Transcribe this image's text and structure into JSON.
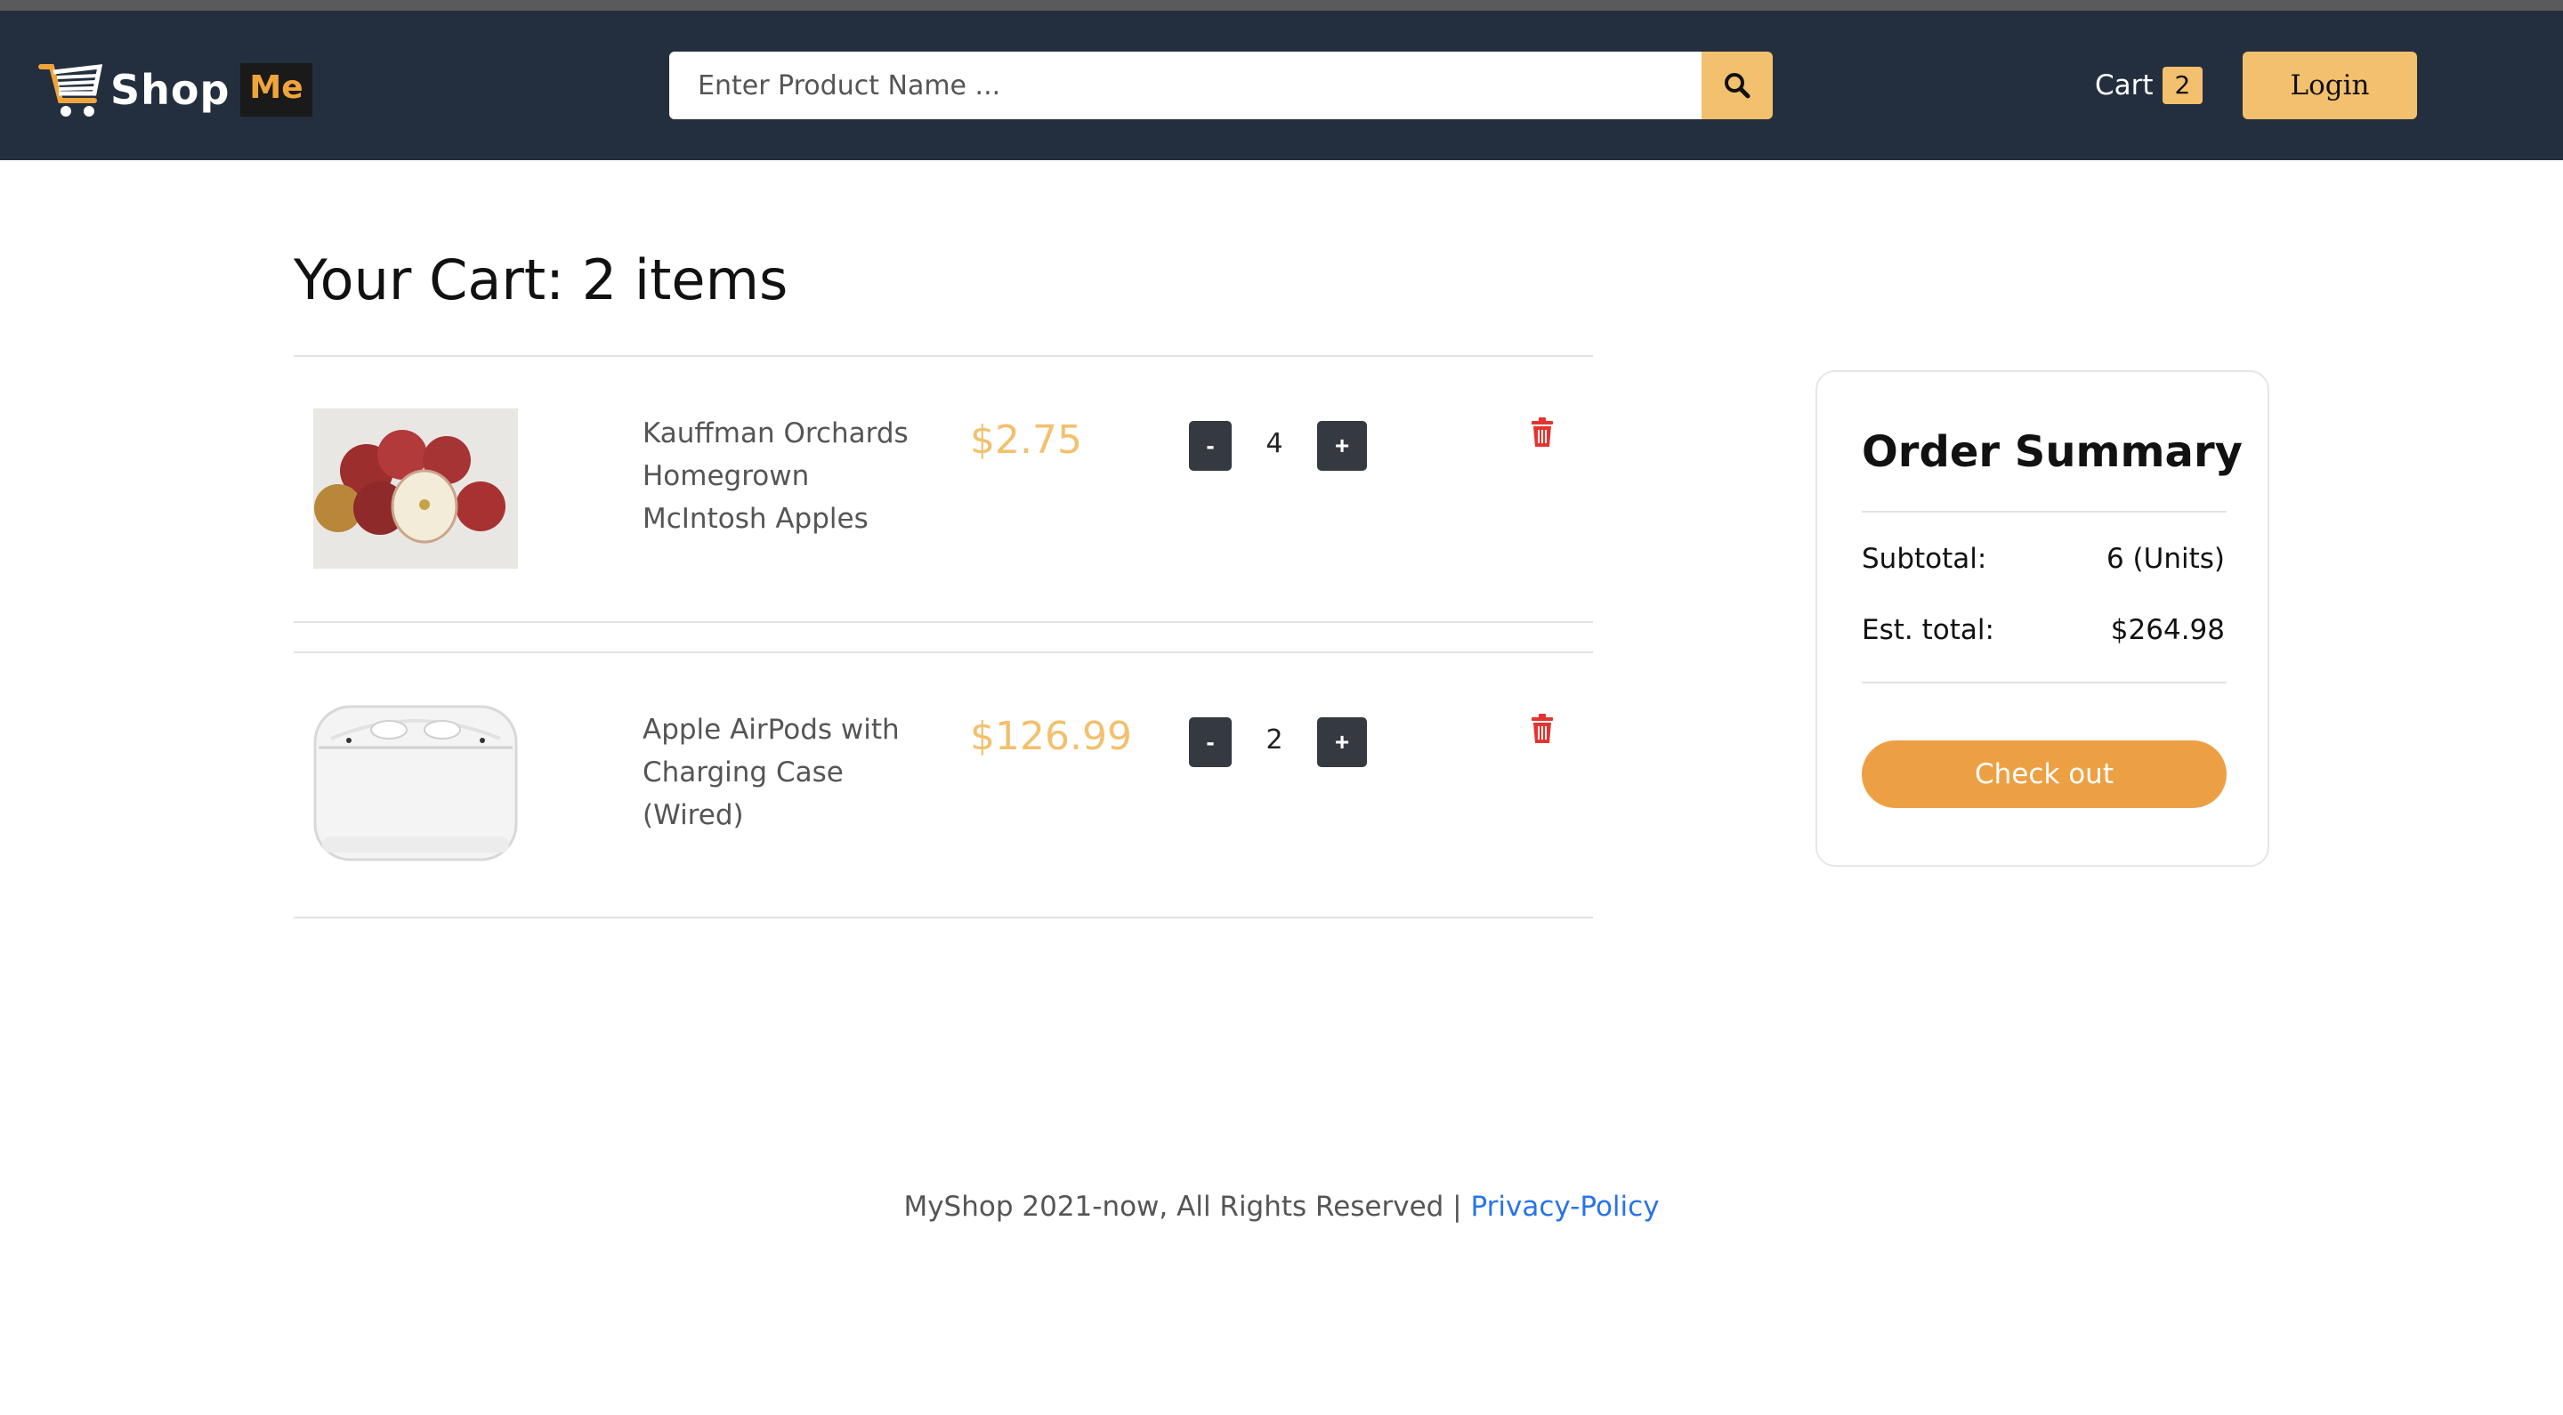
{
  "header": {
    "logo_word": "Shop",
    "logo_badge": "Me",
    "search": {
      "placeholder": "Enter Product Name ...",
      "value": ""
    },
    "cart_label": "Cart",
    "cart_count": "2",
    "login_label": "Login"
  },
  "cart": {
    "title": "Your Cart: 2 items",
    "items": [
      {
        "name_lines": [
          "Kauffman Orchards",
          "Homegrown",
          "McIntosh Apples"
        ],
        "price": "$2.75",
        "quantity": "4",
        "minus_label": "-",
        "plus_label": "+"
      },
      {
        "name_lines": [
          "Apple AirPods with",
          "Charging Case",
          "(Wired)"
        ],
        "price": "$126.99",
        "quantity": "2",
        "minus_label": "-",
        "plus_label": "+"
      }
    ]
  },
  "summary": {
    "title": "Order Summary",
    "subtotal_label": "Subtotal:",
    "subtotal_value": "6 (Units)",
    "total_label": "Est. total:",
    "total_value": "$264.98",
    "checkout_label": "Check out"
  },
  "footer": {
    "text": "MyShop 2021-now, All Rights Reserved | ",
    "link": "Privacy-Policy"
  },
  "colors": {
    "navbar": "#232f3e",
    "accent": "#f3c06e",
    "checkout": "#eda043",
    "delete": "#e3342f",
    "link": "#2874e8"
  }
}
